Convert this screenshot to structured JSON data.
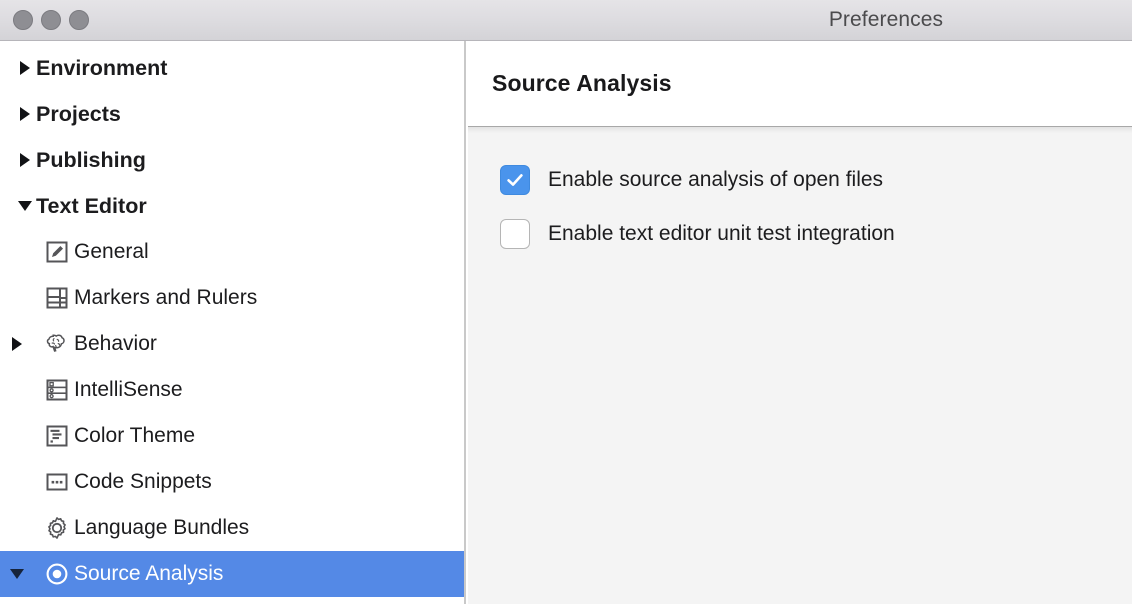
{
  "window": {
    "title": "Preferences",
    "traffic_lights": [
      "close-button",
      "minimize-button",
      "zoom-button"
    ]
  },
  "colors": {
    "selection_blue": "#5489e6",
    "checkbox_blue": "#4a94ec",
    "titlebar_gray": "#dddce0",
    "content_bg": "#f4f4f4",
    "text": "#1c1c1e"
  },
  "sidebar": {
    "items": [
      {
        "label": "Environment",
        "level": 0,
        "twisty": "closed",
        "icon": null,
        "selected": false
      },
      {
        "label": "Projects",
        "level": 0,
        "twisty": "closed",
        "icon": null,
        "selected": false
      },
      {
        "label": "Publishing",
        "level": 0,
        "twisty": "closed",
        "icon": null,
        "selected": false
      },
      {
        "label": "Text Editor",
        "level": 0,
        "twisty": "open",
        "icon": null,
        "selected": false
      },
      {
        "label": "General",
        "level": 1,
        "twisty": "none",
        "icon": "pencil-box-icon",
        "selected": false
      },
      {
        "label": "Markers and Rulers",
        "level": 1,
        "twisty": "none",
        "icon": "grid-panes-icon",
        "selected": false
      },
      {
        "label": "Behavior",
        "level": 1,
        "twisty": "closed",
        "icon": "brain-icon",
        "selected": false
      },
      {
        "label": "IntelliSense",
        "level": 1,
        "twisty": "none",
        "icon": "list-rows-icon",
        "selected": false
      },
      {
        "label": "Color Theme",
        "level": 1,
        "twisty": "none",
        "icon": "code-lines-icon",
        "selected": false
      },
      {
        "label": "Code Snippets",
        "level": 1,
        "twisty": "none",
        "icon": "ellipsis-box-icon",
        "selected": false
      },
      {
        "label": "Language Bundles",
        "level": 1,
        "twisty": "none",
        "icon": "gear-icon",
        "selected": false
      },
      {
        "label": "Source Analysis",
        "level": 1,
        "twisty": "open",
        "icon": "target-radio-icon",
        "selected": true
      }
    ]
  },
  "main": {
    "header_title": "Source Analysis",
    "options": [
      {
        "label": "Enable source analysis of open files",
        "checked": true
      },
      {
        "label": "Enable text editor unit test integration",
        "checked": false
      }
    ]
  }
}
